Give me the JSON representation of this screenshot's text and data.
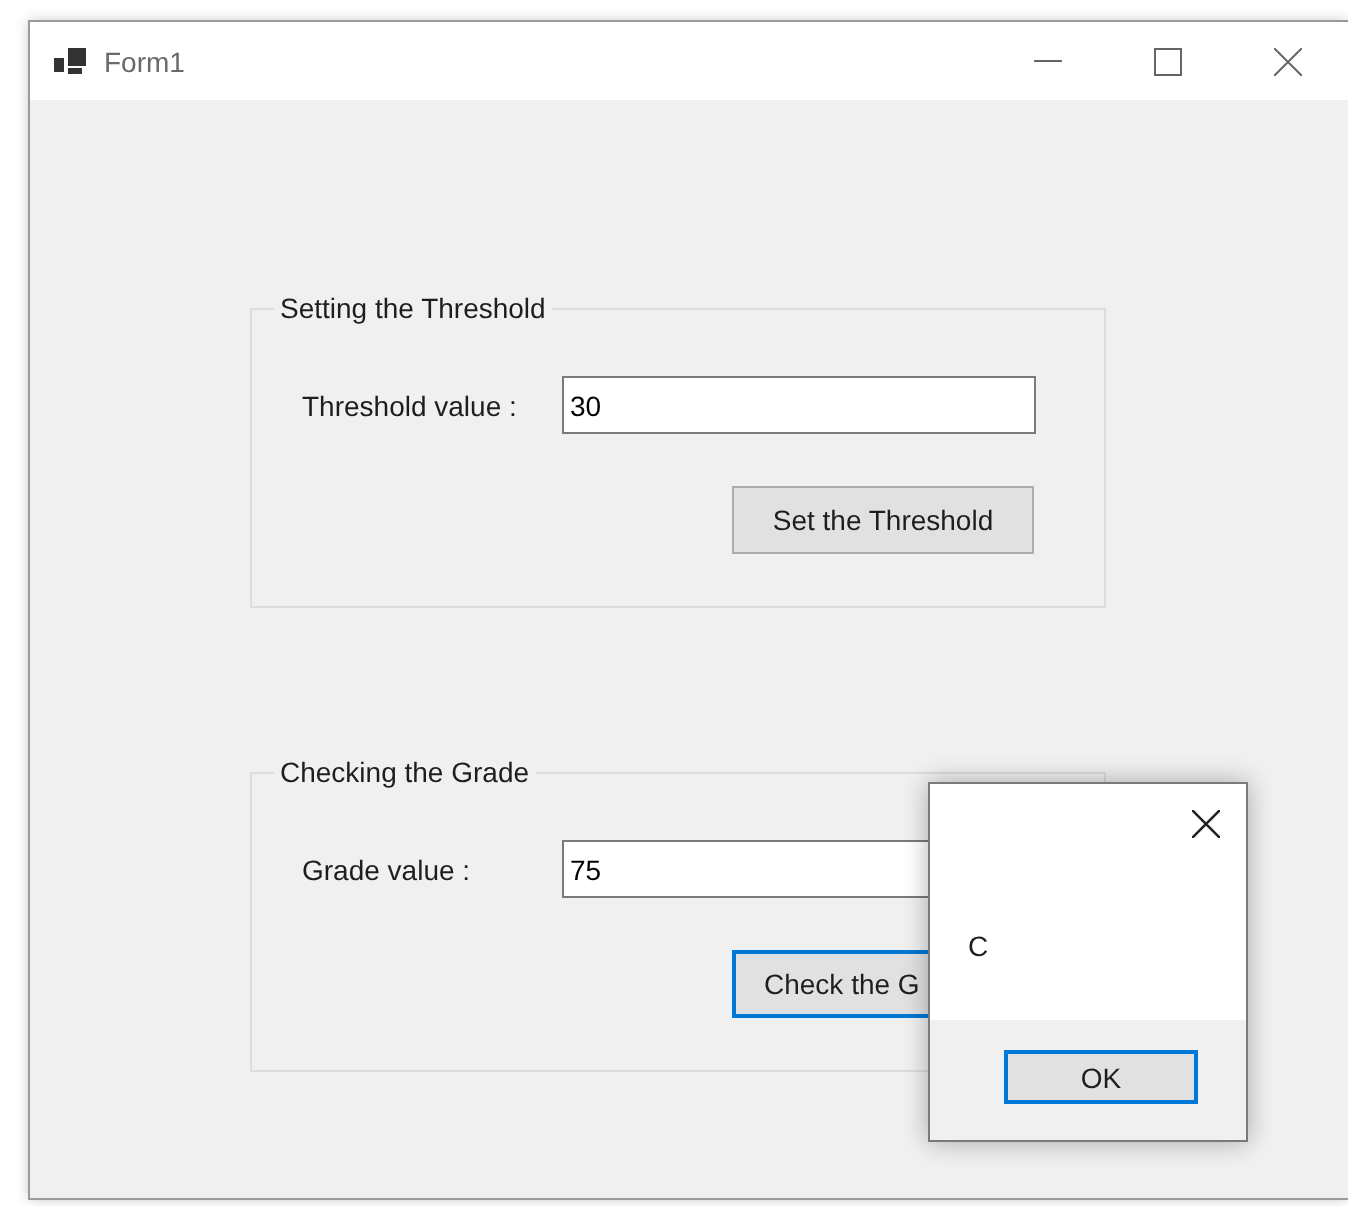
{
  "window": {
    "title": "Form1"
  },
  "groups": [
    {
      "legend": "Setting the Threshold",
      "label": "Threshold value :",
      "value": "30",
      "button": "Set the Threshold",
      "focused": false
    },
    {
      "legend": "Checking the Grade",
      "label": "Grade value :",
      "value": "75",
      "button": "Check the G",
      "focused": true
    }
  ],
  "message_box": {
    "text": "C",
    "button": "OK"
  }
}
